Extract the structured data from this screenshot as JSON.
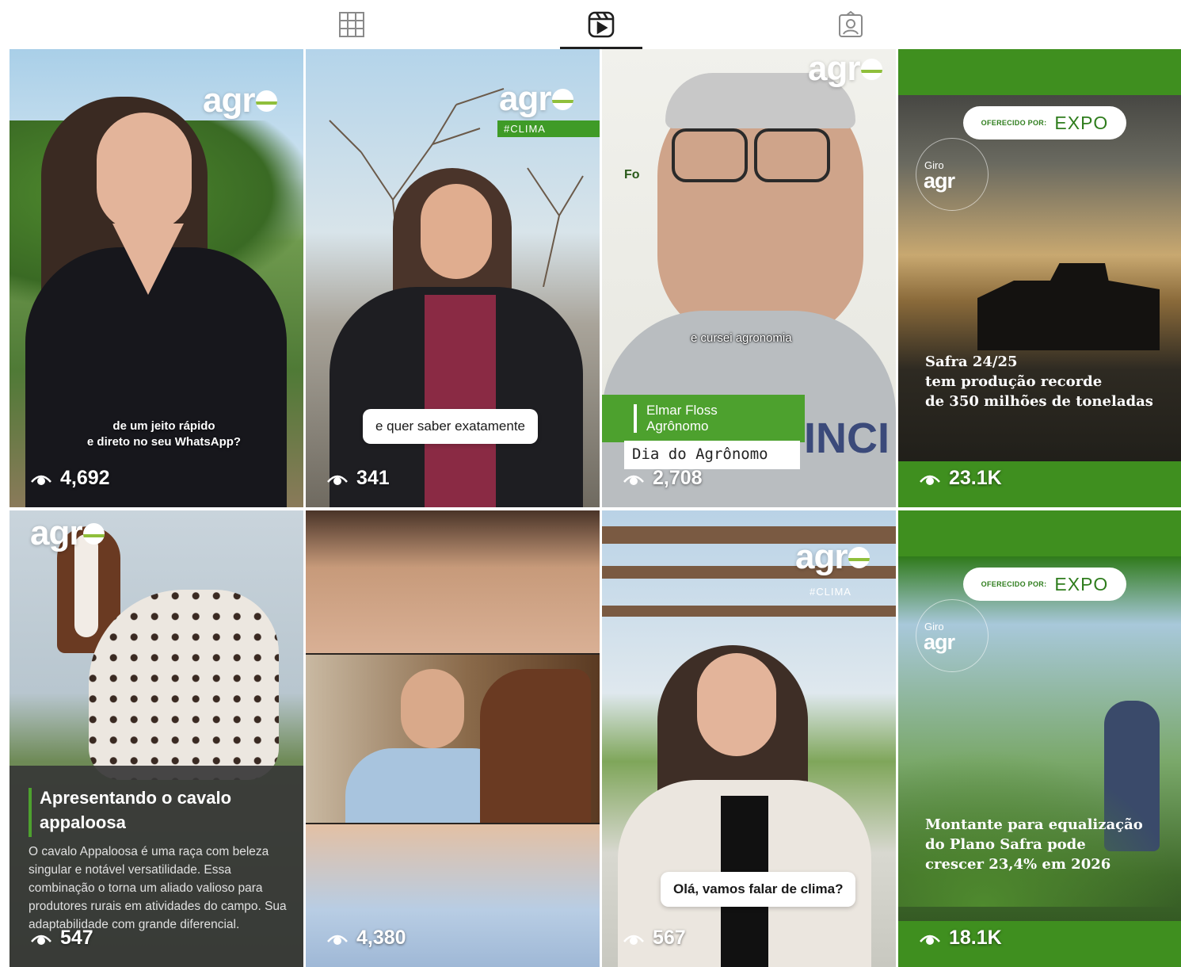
{
  "tabs": [
    {
      "name": "posts",
      "icon": "grid-icon",
      "active": false
    },
    {
      "name": "reels",
      "icon": "reels-icon",
      "active": true
    },
    {
      "name": "tagged",
      "icon": "tagged-icon",
      "active": false
    }
  ],
  "brand": {
    "logo_text": "agr",
    "tag_clima": "#CLIMA",
    "accent": "#3f9b27"
  },
  "reels": [
    {
      "views": "4,692",
      "caption": "de um jeito rápido\ne direto no seu WhatsApp?"
    },
    {
      "views": "341",
      "caption": "e quer saber exatamente",
      "tag": "#CLIMA"
    },
    {
      "views": "2,708",
      "subtitle": "e cursei agronomia",
      "person_name": "Elmar Floss\nAgrônomo",
      "banner": "Dia do Agrônomo",
      "bg_sign": "Fo"
    },
    {
      "views": "23.1K",
      "sponsor_label": "OFERECIDO POR:",
      "sponsor": "EXPO",
      "giro": "Giro",
      "giro_brand": "agr",
      "headline": "Safra 24/25\ntem produção recorde\nde 350 milhões de toneladas"
    },
    {
      "views": "547",
      "article_title": "Apresentando o cavalo appaloosa",
      "article_body": "O cavalo Appaloosa é uma raça com beleza singular e notável versatilidade. Essa combinação o torna um aliado valioso para produtores rurais em atividades do campo. Sua adaptabilidade com grande diferencial."
    },
    {
      "views": "4,380"
    },
    {
      "views": "567",
      "caption": "Olá, vamos falar de clima?",
      "tag": "#CLIMA"
    },
    {
      "views": "18.1K",
      "sponsor_label": "OFERECIDO POR:",
      "sponsor": "EXPO",
      "giro": "Giro",
      "giro_brand": "agr",
      "headline": "Montante para equalização\ndo Plano Safra pode\ncrescer 23,4% em 2026"
    }
  ]
}
